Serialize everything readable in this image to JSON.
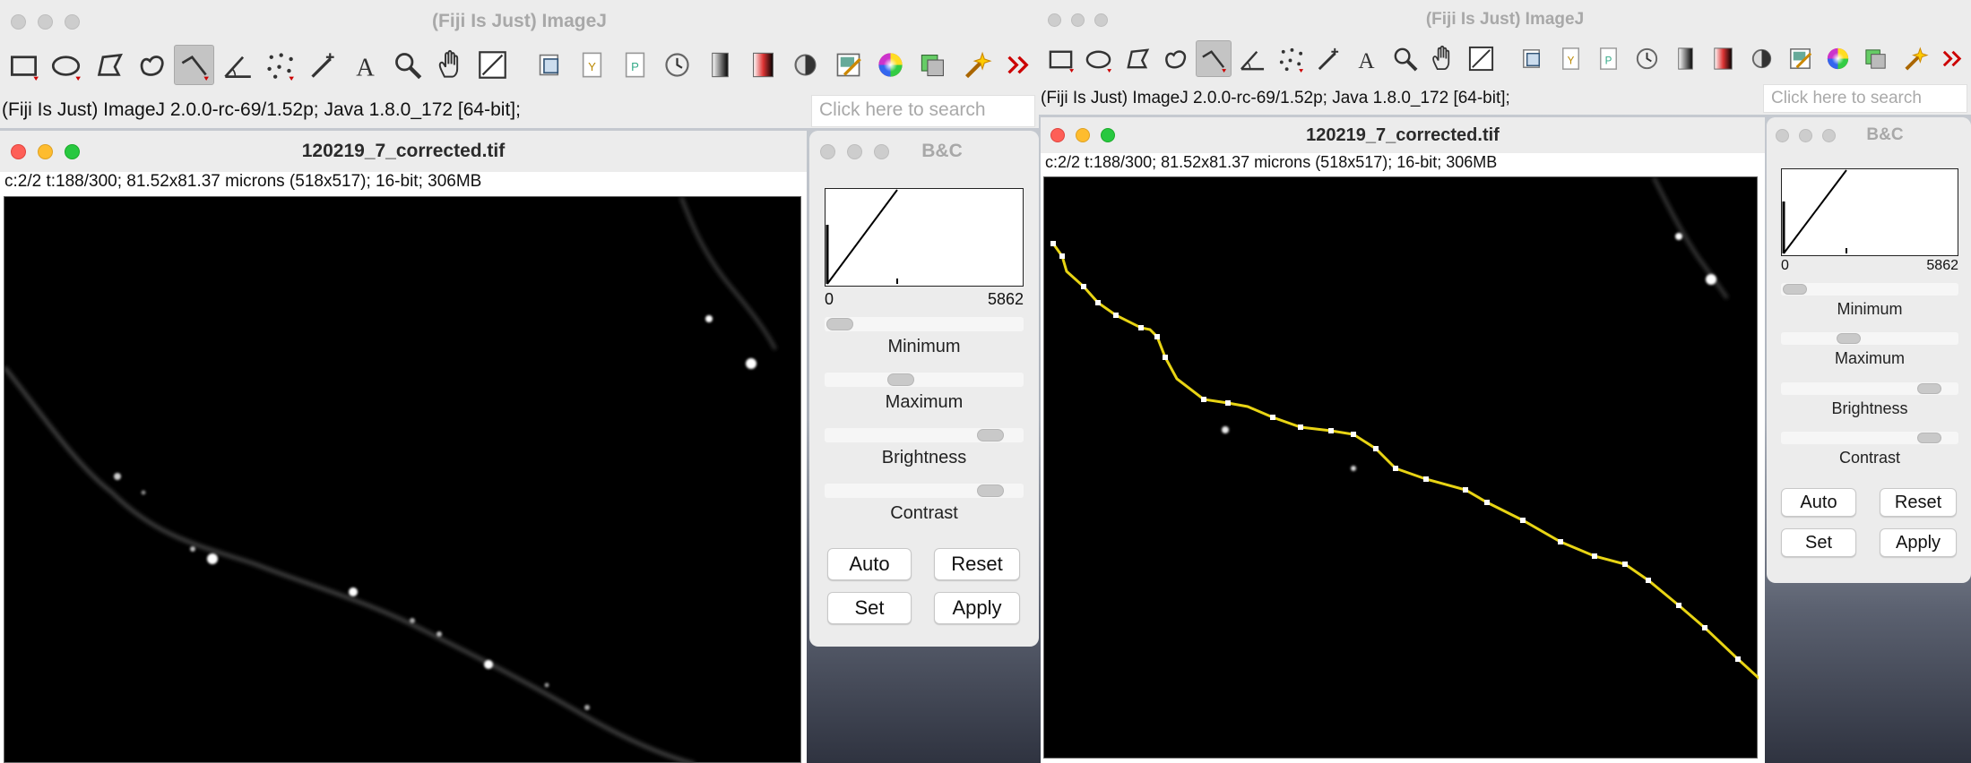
{
  "left": {
    "main_title": "(Fiji Is Just) ImageJ",
    "status_text": "(Fiji Is Just) ImageJ 2.0.0-rc-69/1.52p; Java 1.8.0_172 [64-bit];",
    "search_placeholder": "Click here to search",
    "image_title": "120219_7_corrected.tif",
    "image_info": "c:2/2 t:188/300; 81.52x81.37 microns (518x517); 16-bit; 306MB",
    "bc": {
      "title": "B&C",
      "hist_min": "0",
      "hist_max": "5862",
      "minimum_label": "Minimum",
      "maximum_label": "Maximum",
      "brightness_label": "Brightness",
      "contrast_label": "Contrast",
      "auto_label": "Auto",
      "reset_label": "Reset",
      "set_label": "Set",
      "apply_label": "Apply"
    }
  },
  "right": {
    "main_title": "(Fiji Is Just) ImageJ",
    "status_text": "(Fiji Is Just) ImageJ 2.0.0-rc-69/1.52p; Java 1.8.0_172 [64-bit];",
    "search_placeholder": "Click here to search",
    "image_title": "120219_7_corrected.tif",
    "image_info": "c:2/2 t:188/300; 81.52x81.37 microns (518x517); 16-bit; 306MB",
    "bc": {
      "title": "B&C",
      "hist_min": "0",
      "hist_max": "5862",
      "minimum_label": "Minimum",
      "maximum_label": "Maximum",
      "brightness_label": "Brightness",
      "contrast_label": "Contrast",
      "auto_label": "Auto",
      "reset_label": "Reset",
      "set_label": "Set",
      "apply_label": "Apply"
    }
  },
  "tools": [
    "rectangle-tool-icon",
    "oval-tool-icon",
    "polygon-tool-icon",
    "freehand-tool-icon",
    "segmented-line-tool-icon",
    "angle-tool-icon",
    "multipoint-tool-icon",
    "wand-tool-icon",
    "text-tool-icon",
    "magnifier-tool-icon",
    "hand-tool-icon",
    "color-picker-icon",
    "stack-icon",
    "y-icon",
    "p-icon",
    "clock-icon",
    "lut-gray-icon",
    "lut-fire-icon",
    "contrast-icon",
    "edit-icon",
    "color-wheel-icon",
    "channels-icon",
    "magic-icon",
    "more-tools-icon"
  ],
  "colors": {
    "accent_line": "#e8d414",
    "selected_tool": "#c4c4c4"
  }
}
